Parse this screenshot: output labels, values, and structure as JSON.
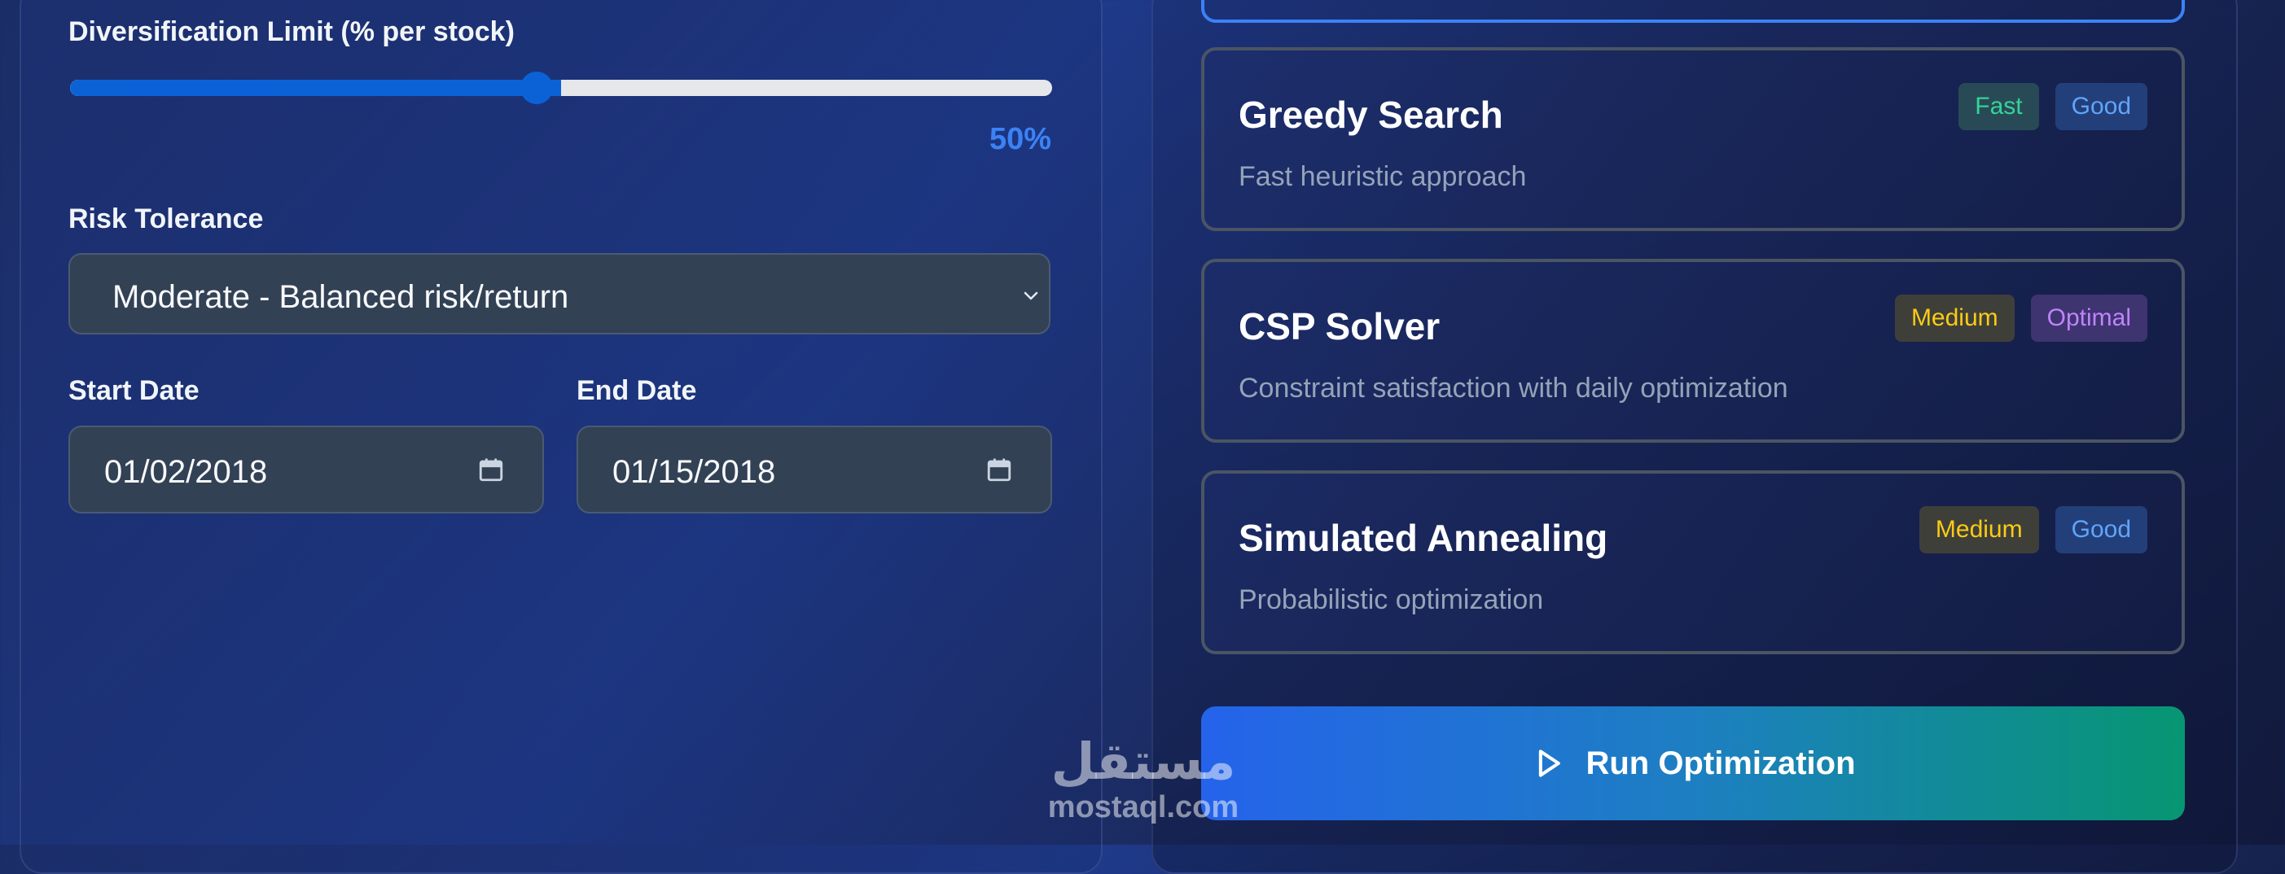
{
  "config": {
    "diversification": {
      "label": "Diversification Limit (% per stock)",
      "value_text": "50%",
      "value": 0.5
    },
    "risk": {
      "label": "Risk Tolerance",
      "selected": "Moderate - Balanced risk/return"
    },
    "start_date": {
      "label": "Start Date",
      "value": "01/02/2018"
    },
    "end_date": {
      "label": "End Date",
      "value": "01/15/2018"
    }
  },
  "algorithms": [
    {
      "title": "Greedy Search",
      "desc": "Fast heuristic approach",
      "badges": [
        {
          "text": "Fast",
          "color": "#34d399",
          "bg": "#284a56"
        },
        {
          "text": "Good",
          "color": "#60a5fa",
          "bg": "#233f7a"
        }
      ]
    },
    {
      "title": "CSP Solver",
      "desc": "Constraint satisfaction with daily optimization",
      "badges": [
        {
          "text": "Medium",
          "color": "#facc15",
          "bg": "#3f3f3a"
        },
        {
          "text": "Optimal",
          "color": "#c084fc",
          "bg": "#3e3470"
        }
      ]
    },
    {
      "title": "Simulated Annealing",
      "desc": "Probabilistic optimization",
      "badges": [
        {
          "text": "Medium",
          "color": "#facc15",
          "bg": "#3f3f3a"
        },
        {
          "text": "Good",
          "color": "#60a5fa",
          "bg": "#233f7a"
        }
      ]
    }
  ],
  "run_button": {
    "label": "Run Optimization",
    "icon": "play-icon"
  },
  "watermark": {
    "arabic": "مستقل",
    "latin": "mostaql.com"
  },
  "colors": {
    "accent": "#3b82f6",
    "slider": "#0b62d6",
    "selected_border": "#3b82f6"
  }
}
